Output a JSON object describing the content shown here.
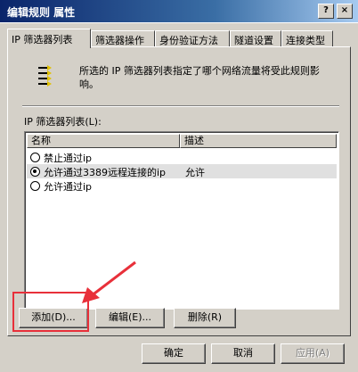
{
  "window": {
    "title": "编辑规则 属性",
    "help_label": "?",
    "close_label": "×"
  },
  "tabs": [
    {
      "label": "IP 筛选器列表",
      "active": true
    },
    {
      "label": "筛选器操作",
      "active": false
    },
    {
      "label": "身份验证方法",
      "active": false
    },
    {
      "label": "隧道设置",
      "active": false
    },
    {
      "label": "连接类型",
      "active": false
    }
  ],
  "description": {
    "icon": "filter-list-icon",
    "text": "所选的 IP 筛选器列表指定了哪个网络流量将受此规则影响。"
  },
  "filter_list": {
    "label": "IP 筛选器列表(L):",
    "columns": [
      "名称",
      "描述"
    ],
    "rows": [
      {
        "name": "禁止通过ip",
        "desc": "",
        "checked": false
      },
      {
        "name": "允许通过3389远程连接的ip",
        "desc": "允许",
        "checked": true
      },
      {
        "name": "允许通过ip",
        "desc": "",
        "checked": false
      }
    ]
  },
  "actions": {
    "add": "添加(D)...",
    "edit": "编辑(E)...",
    "delete": "删除(R)"
  },
  "footer": {
    "ok": "确定",
    "cancel": "取消",
    "apply": "应用(A)"
  },
  "colors": {
    "titlebar": "#0a246a",
    "face": "#d4d0c8",
    "highlight_annotation": "#e8303a"
  }
}
